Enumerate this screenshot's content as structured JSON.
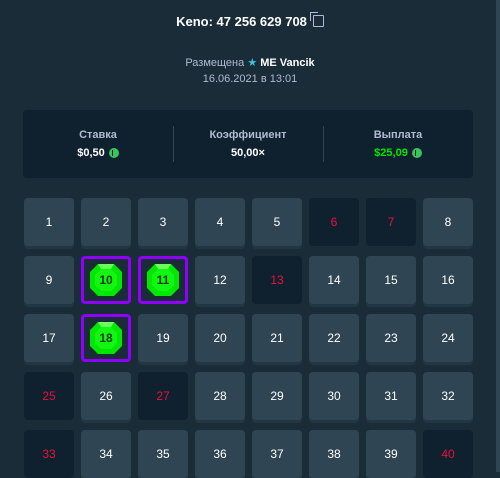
{
  "header": {
    "title": "Keno: 47 256 629 708"
  },
  "placed": {
    "prefix": "Размещена",
    "user": "ME Vancik",
    "date": "16.06.2021 в 13:01"
  },
  "stats": [
    {
      "label": "Ставка",
      "value": "$0,50",
      "coin": true,
      "green": false
    },
    {
      "label": "Коэффициент",
      "value": "50,00×",
      "coin": false,
      "green": false
    },
    {
      "label": "Выплата",
      "value": "$25,09",
      "coin": true,
      "green": true
    }
  ],
  "grid": {
    "cells": [
      {
        "n": "1",
        "s": "normal"
      },
      {
        "n": "2",
        "s": "normal"
      },
      {
        "n": "3",
        "s": "normal"
      },
      {
        "n": "4",
        "s": "normal"
      },
      {
        "n": "5",
        "s": "normal"
      },
      {
        "n": "6",
        "s": "miss"
      },
      {
        "n": "7",
        "s": "miss"
      },
      {
        "n": "8",
        "s": "normal"
      },
      {
        "n": "9",
        "s": "normal"
      },
      {
        "n": "10",
        "s": "hit"
      },
      {
        "n": "11",
        "s": "hit"
      },
      {
        "n": "12",
        "s": "normal"
      },
      {
        "n": "13",
        "s": "miss"
      },
      {
        "n": "14",
        "s": "normal"
      },
      {
        "n": "15",
        "s": "normal"
      },
      {
        "n": "16",
        "s": "normal"
      },
      {
        "n": "17",
        "s": "normal"
      },
      {
        "n": "18",
        "s": "hit"
      },
      {
        "n": "19",
        "s": "normal"
      },
      {
        "n": "20",
        "s": "normal"
      },
      {
        "n": "21",
        "s": "normal"
      },
      {
        "n": "22",
        "s": "normal"
      },
      {
        "n": "23",
        "s": "normal"
      },
      {
        "n": "24",
        "s": "normal"
      },
      {
        "n": "25",
        "s": "miss"
      },
      {
        "n": "26",
        "s": "normal"
      },
      {
        "n": "27",
        "s": "miss"
      },
      {
        "n": "28",
        "s": "normal"
      },
      {
        "n": "29",
        "s": "normal"
      },
      {
        "n": "30",
        "s": "normal"
      },
      {
        "n": "31",
        "s": "normal"
      },
      {
        "n": "32",
        "s": "normal"
      },
      {
        "n": "33",
        "s": "miss"
      },
      {
        "n": "34",
        "s": "normal"
      },
      {
        "n": "35",
        "s": "normal"
      },
      {
        "n": "36",
        "s": "normal"
      },
      {
        "n": "37",
        "s": "normal"
      },
      {
        "n": "38",
        "s": "normal"
      },
      {
        "n": "39",
        "s": "normal"
      },
      {
        "n": "40",
        "s": "miss"
      }
    ]
  },
  "colors": {
    "background": "#1a2c38",
    "tile": "#2f4553",
    "miss_tile": "#0f212e",
    "miss_text": "#e9113c",
    "hit_border": "#9000ff",
    "gem": "#00e701",
    "payout": "#00e701"
  },
  "icons": {
    "copy": "copy-icon",
    "star": "star-icon",
    "coin": "coin-icon",
    "gem": "gem-icon"
  }
}
